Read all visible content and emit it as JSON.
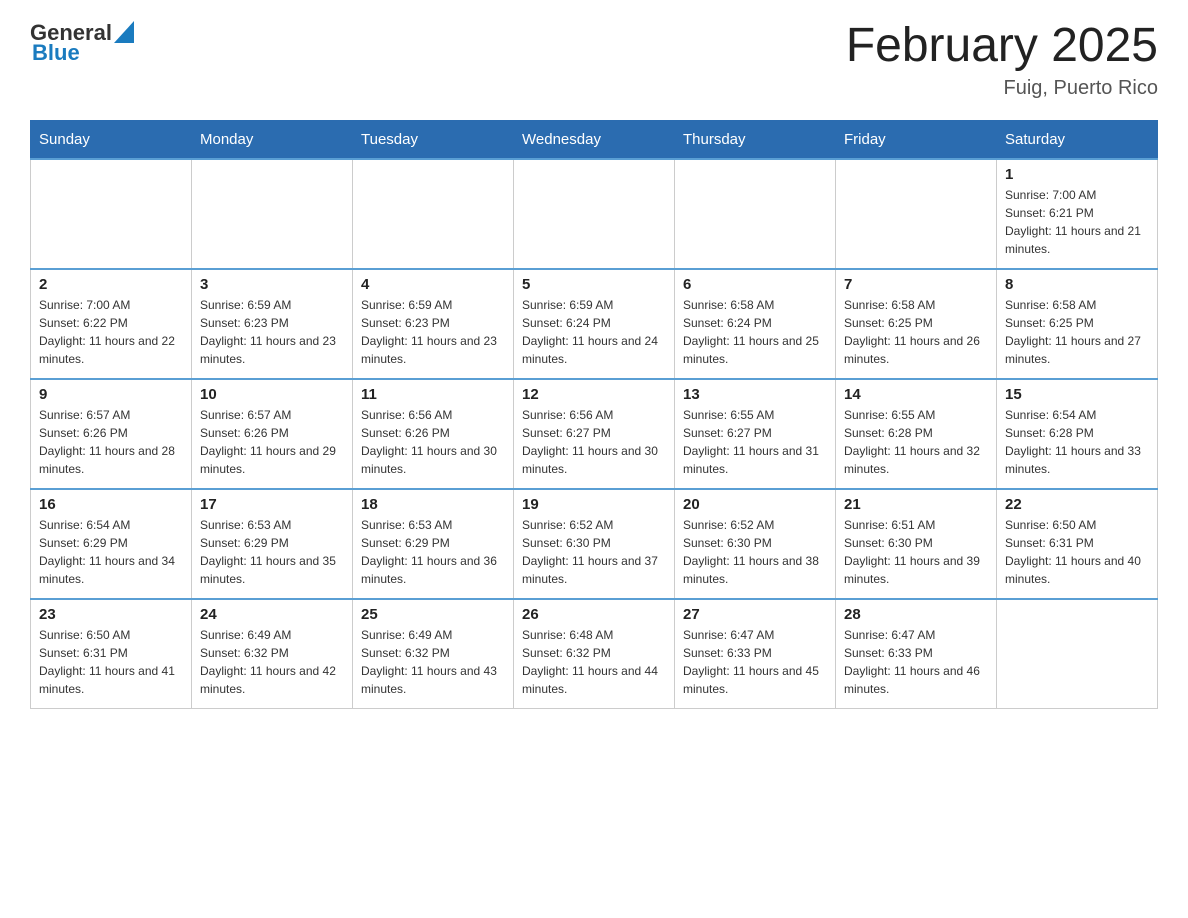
{
  "header": {
    "logo": {
      "general": "General",
      "blue": "Blue"
    },
    "title": "February 2025",
    "location": "Fuig, Puerto Rico"
  },
  "days_of_week": [
    "Sunday",
    "Monday",
    "Tuesday",
    "Wednesday",
    "Thursday",
    "Friday",
    "Saturday"
  ],
  "weeks": [
    [
      {
        "day": "",
        "sunrise": "",
        "sunset": "",
        "daylight": ""
      },
      {
        "day": "",
        "sunrise": "",
        "sunset": "",
        "daylight": ""
      },
      {
        "day": "",
        "sunrise": "",
        "sunset": "",
        "daylight": ""
      },
      {
        "day": "",
        "sunrise": "",
        "sunset": "",
        "daylight": ""
      },
      {
        "day": "",
        "sunrise": "",
        "sunset": "",
        "daylight": ""
      },
      {
        "day": "",
        "sunrise": "",
        "sunset": "",
        "daylight": ""
      },
      {
        "day": "1",
        "sunrise": "Sunrise: 7:00 AM",
        "sunset": "Sunset: 6:21 PM",
        "daylight": "Daylight: 11 hours and 21 minutes."
      }
    ],
    [
      {
        "day": "2",
        "sunrise": "Sunrise: 7:00 AM",
        "sunset": "Sunset: 6:22 PM",
        "daylight": "Daylight: 11 hours and 22 minutes."
      },
      {
        "day": "3",
        "sunrise": "Sunrise: 6:59 AM",
        "sunset": "Sunset: 6:23 PM",
        "daylight": "Daylight: 11 hours and 23 minutes."
      },
      {
        "day": "4",
        "sunrise": "Sunrise: 6:59 AM",
        "sunset": "Sunset: 6:23 PM",
        "daylight": "Daylight: 11 hours and 23 minutes."
      },
      {
        "day": "5",
        "sunrise": "Sunrise: 6:59 AM",
        "sunset": "Sunset: 6:24 PM",
        "daylight": "Daylight: 11 hours and 24 minutes."
      },
      {
        "day": "6",
        "sunrise": "Sunrise: 6:58 AM",
        "sunset": "Sunset: 6:24 PM",
        "daylight": "Daylight: 11 hours and 25 minutes."
      },
      {
        "day": "7",
        "sunrise": "Sunrise: 6:58 AM",
        "sunset": "Sunset: 6:25 PM",
        "daylight": "Daylight: 11 hours and 26 minutes."
      },
      {
        "day": "8",
        "sunrise": "Sunrise: 6:58 AM",
        "sunset": "Sunset: 6:25 PM",
        "daylight": "Daylight: 11 hours and 27 minutes."
      }
    ],
    [
      {
        "day": "9",
        "sunrise": "Sunrise: 6:57 AM",
        "sunset": "Sunset: 6:26 PM",
        "daylight": "Daylight: 11 hours and 28 minutes."
      },
      {
        "day": "10",
        "sunrise": "Sunrise: 6:57 AM",
        "sunset": "Sunset: 6:26 PM",
        "daylight": "Daylight: 11 hours and 29 minutes."
      },
      {
        "day": "11",
        "sunrise": "Sunrise: 6:56 AM",
        "sunset": "Sunset: 6:26 PM",
        "daylight": "Daylight: 11 hours and 30 minutes."
      },
      {
        "day": "12",
        "sunrise": "Sunrise: 6:56 AM",
        "sunset": "Sunset: 6:27 PM",
        "daylight": "Daylight: 11 hours and 30 minutes."
      },
      {
        "day": "13",
        "sunrise": "Sunrise: 6:55 AM",
        "sunset": "Sunset: 6:27 PM",
        "daylight": "Daylight: 11 hours and 31 minutes."
      },
      {
        "day": "14",
        "sunrise": "Sunrise: 6:55 AM",
        "sunset": "Sunset: 6:28 PM",
        "daylight": "Daylight: 11 hours and 32 minutes."
      },
      {
        "day": "15",
        "sunrise": "Sunrise: 6:54 AM",
        "sunset": "Sunset: 6:28 PM",
        "daylight": "Daylight: 11 hours and 33 minutes."
      }
    ],
    [
      {
        "day": "16",
        "sunrise": "Sunrise: 6:54 AM",
        "sunset": "Sunset: 6:29 PM",
        "daylight": "Daylight: 11 hours and 34 minutes."
      },
      {
        "day": "17",
        "sunrise": "Sunrise: 6:53 AM",
        "sunset": "Sunset: 6:29 PM",
        "daylight": "Daylight: 11 hours and 35 minutes."
      },
      {
        "day": "18",
        "sunrise": "Sunrise: 6:53 AM",
        "sunset": "Sunset: 6:29 PM",
        "daylight": "Daylight: 11 hours and 36 minutes."
      },
      {
        "day": "19",
        "sunrise": "Sunrise: 6:52 AM",
        "sunset": "Sunset: 6:30 PM",
        "daylight": "Daylight: 11 hours and 37 minutes."
      },
      {
        "day": "20",
        "sunrise": "Sunrise: 6:52 AM",
        "sunset": "Sunset: 6:30 PM",
        "daylight": "Daylight: 11 hours and 38 minutes."
      },
      {
        "day": "21",
        "sunrise": "Sunrise: 6:51 AM",
        "sunset": "Sunset: 6:30 PM",
        "daylight": "Daylight: 11 hours and 39 minutes."
      },
      {
        "day": "22",
        "sunrise": "Sunrise: 6:50 AM",
        "sunset": "Sunset: 6:31 PM",
        "daylight": "Daylight: 11 hours and 40 minutes."
      }
    ],
    [
      {
        "day": "23",
        "sunrise": "Sunrise: 6:50 AM",
        "sunset": "Sunset: 6:31 PM",
        "daylight": "Daylight: 11 hours and 41 minutes."
      },
      {
        "day": "24",
        "sunrise": "Sunrise: 6:49 AM",
        "sunset": "Sunset: 6:32 PM",
        "daylight": "Daylight: 11 hours and 42 minutes."
      },
      {
        "day": "25",
        "sunrise": "Sunrise: 6:49 AM",
        "sunset": "Sunset: 6:32 PM",
        "daylight": "Daylight: 11 hours and 43 minutes."
      },
      {
        "day": "26",
        "sunrise": "Sunrise: 6:48 AM",
        "sunset": "Sunset: 6:32 PM",
        "daylight": "Daylight: 11 hours and 44 minutes."
      },
      {
        "day": "27",
        "sunrise": "Sunrise: 6:47 AM",
        "sunset": "Sunset: 6:33 PM",
        "daylight": "Daylight: 11 hours and 45 minutes."
      },
      {
        "day": "28",
        "sunrise": "Sunrise: 6:47 AM",
        "sunset": "Sunset: 6:33 PM",
        "daylight": "Daylight: 11 hours and 46 minutes."
      },
      {
        "day": "",
        "sunrise": "",
        "sunset": "",
        "daylight": ""
      }
    ]
  ]
}
